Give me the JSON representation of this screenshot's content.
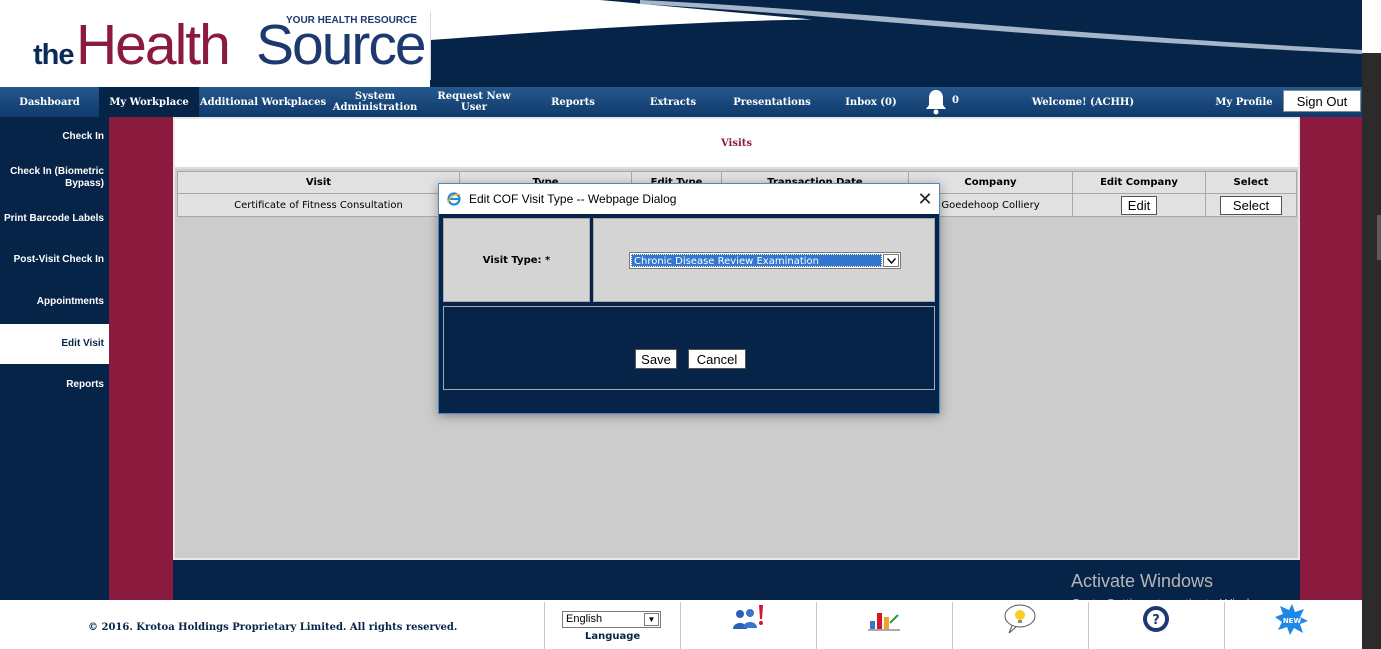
{
  "logo": {
    "prefix": "the",
    "part1": "Health",
    "part2": "Source",
    "tagline": "YOUR HEALTH RESOURCE"
  },
  "nav": {
    "items": [
      {
        "label": "Dashboard"
      },
      {
        "label": "My Workplace"
      },
      {
        "label": "Additional Workplaces"
      },
      {
        "label": "System Administration"
      },
      {
        "label": "Request New User"
      },
      {
        "label": "Reports"
      },
      {
        "label": "Extracts"
      },
      {
        "label": "Presentations"
      },
      {
        "label": "Inbox (0)"
      }
    ],
    "notifications_count": "0",
    "welcome": "Welcome! (ACHH)",
    "profile": "My Profile",
    "signout": "Sign Out"
  },
  "sidebar": {
    "items": [
      {
        "label": "Check In"
      },
      {
        "label": "Check In (Biometric Bypass)"
      },
      {
        "label": "Print Barcode Labels"
      },
      {
        "label": "Post-Visit Check In"
      },
      {
        "label": "Appointments"
      },
      {
        "label": "Edit Visit"
      },
      {
        "label": "Reports"
      }
    ],
    "active_index": 5
  },
  "main": {
    "title": "Visits",
    "table": {
      "headers": [
        "Visit",
        "Type",
        "Edit Type",
        "Transaction Date",
        "Company",
        "Edit Company",
        "Select"
      ],
      "rows": [
        {
          "visit": "Certificate of Fitness Consultation",
          "company": "Goedehoop Colliery",
          "edit_label": "Edit",
          "select_label": "Select"
        }
      ]
    }
  },
  "dialog": {
    "title": "Edit COF Visit Type -- Webpage Dialog",
    "field_label": "Visit Type: *",
    "selected_value": "Chronic Disease Review Examination",
    "save_label": "Save",
    "cancel_label": "Cancel"
  },
  "watermark": {
    "title": "Activate Windows",
    "subtitle": "Go to Settings to activate Windows."
  },
  "footer": {
    "copyright": "© 2016. Krotoa Holdings Proprietary Limited. All rights reserved.",
    "language_value": "English",
    "language_label": "Language"
  },
  "colors": {
    "navy": "#062448",
    "maroon": "#8b1a3f",
    "nav_gradient_top": "#26588d",
    "selection_blue": "#3376d0"
  }
}
